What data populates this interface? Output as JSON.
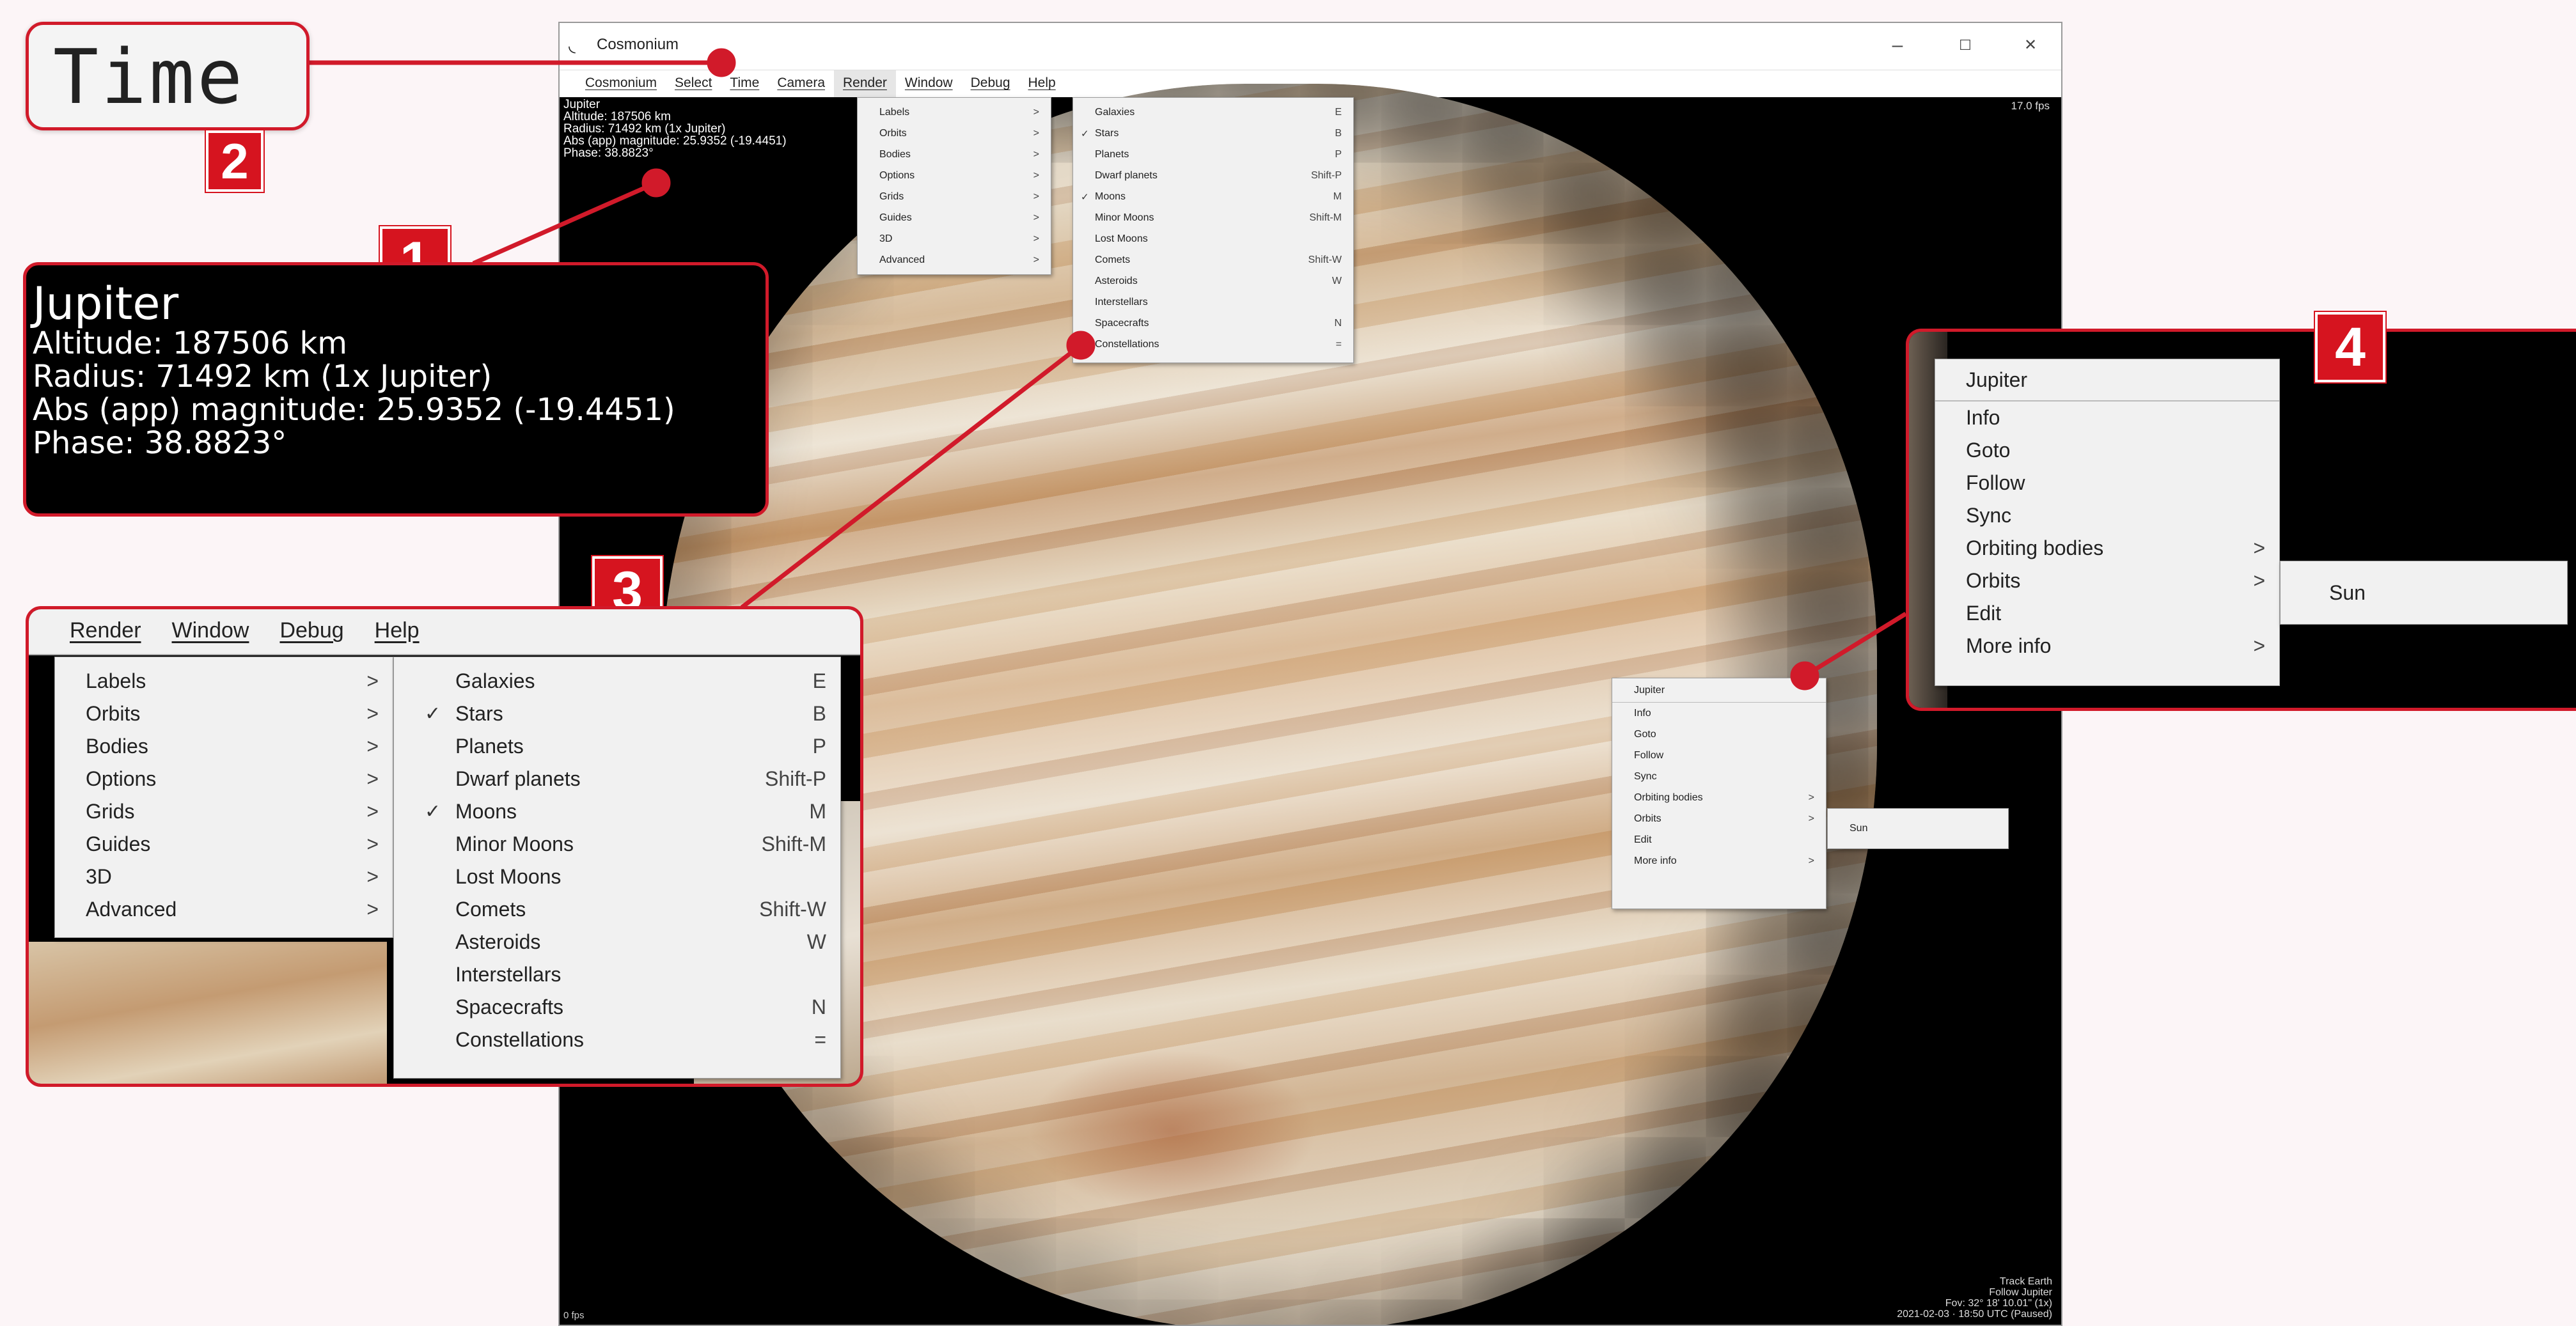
{
  "window": {
    "title": "Cosmonium",
    "controls": {
      "minimize": "–",
      "maximize": "☐",
      "close": "✕"
    },
    "icon": "cosmonium-app-icon"
  },
  "menubar": [
    "Cosmonium",
    "Select",
    "Time",
    "Camera",
    "Render",
    "Window",
    "Debug",
    "Help"
  ],
  "object_info": {
    "name": "Jupiter",
    "altitude": "Altitude: 187506 km",
    "radius": "Radius: 71492 km (1x Jupiter)",
    "magnitude": "Abs (app) magnitude: 25.9352 (-19.4451)",
    "phase": "Phase: 38.8823°"
  },
  "fps": "17.0 fps",
  "bottom_info": [
    "Track Earth",
    "Follow Jupiter",
    "Fov: 32° 18' 10.01\" (1x)",
    "2021-02-03 · 18:50 UTC (Paused)"
  ],
  "bottom_left": "0 fps",
  "render_menu": {
    "items": [
      {
        "label": "Labels",
        "arrow": ">"
      },
      {
        "label": "Orbits",
        "arrow": ">"
      },
      {
        "label": "Bodies",
        "arrow": ">"
      },
      {
        "label": "Options",
        "arrow": ">"
      },
      {
        "label": "Grids",
        "arrow": ">"
      },
      {
        "label": "Guides",
        "arrow": ">"
      },
      {
        "label": "3D",
        "arrow": ">"
      },
      {
        "label": "Advanced",
        "arrow": ">"
      }
    ]
  },
  "bodies_menu": {
    "items": [
      {
        "label": "Galaxies",
        "shortcut": "E",
        "checked": false
      },
      {
        "label": "Stars",
        "shortcut": "B",
        "checked": true
      },
      {
        "label": "Planets",
        "shortcut": "P",
        "checked": false
      },
      {
        "label": "Dwarf planets",
        "shortcut": "Shift-P",
        "checked": false
      },
      {
        "label": "Moons",
        "shortcut": "M",
        "checked": true
      },
      {
        "label": "Minor Moons",
        "shortcut": "Shift-M",
        "checked": false
      },
      {
        "label": "Lost Moons",
        "shortcut": "",
        "checked": false
      },
      {
        "label": "Comets",
        "shortcut": "Shift-W",
        "checked": false
      },
      {
        "label": "Asteroids",
        "shortcut": "W",
        "checked": false
      },
      {
        "label": "Interstellars",
        "shortcut": "",
        "checked": false
      },
      {
        "label": "Spacecrafts",
        "shortcut": "N",
        "checked": false
      },
      {
        "label": "Constellations",
        "shortcut": "=",
        "checked": false
      }
    ],
    "check_mark": "✓"
  },
  "context_menu": {
    "title": "Jupiter",
    "items": [
      {
        "label": "Info",
        "arrow": ""
      },
      {
        "label": "Goto",
        "arrow": ""
      },
      {
        "label": "Follow",
        "arrow": ""
      },
      {
        "label": "Sync",
        "arrow": ""
      },
      {
        "label": "Orbiting bodies",
        "arrow": ">"
      },
      {
        "label": "Orbits",
        "arrow": ">"
      },
      {
        "label": "Edit",
        "arrow": ""
      },
      {
        "label": "More info",
        "arrow": ">"
      }
    ],
    "submenu": [
      "Sun"
    ]
  },
  "callouts": {
    "time_label": "Time",
    "badges": [
      "1",
      "2",
      "3",
      "4"
    ],
    "zoom_menubar": [
      "Render",
      "Window",
      "Debug",
      "Help"
    ]
  },
  "colors": {
    "accent": "#d6141f",
    "menu_bg": "#f1f1f1",
    "screen_bg": "#000000",
    "page_bg": "#fcf5f7"
  }
}
